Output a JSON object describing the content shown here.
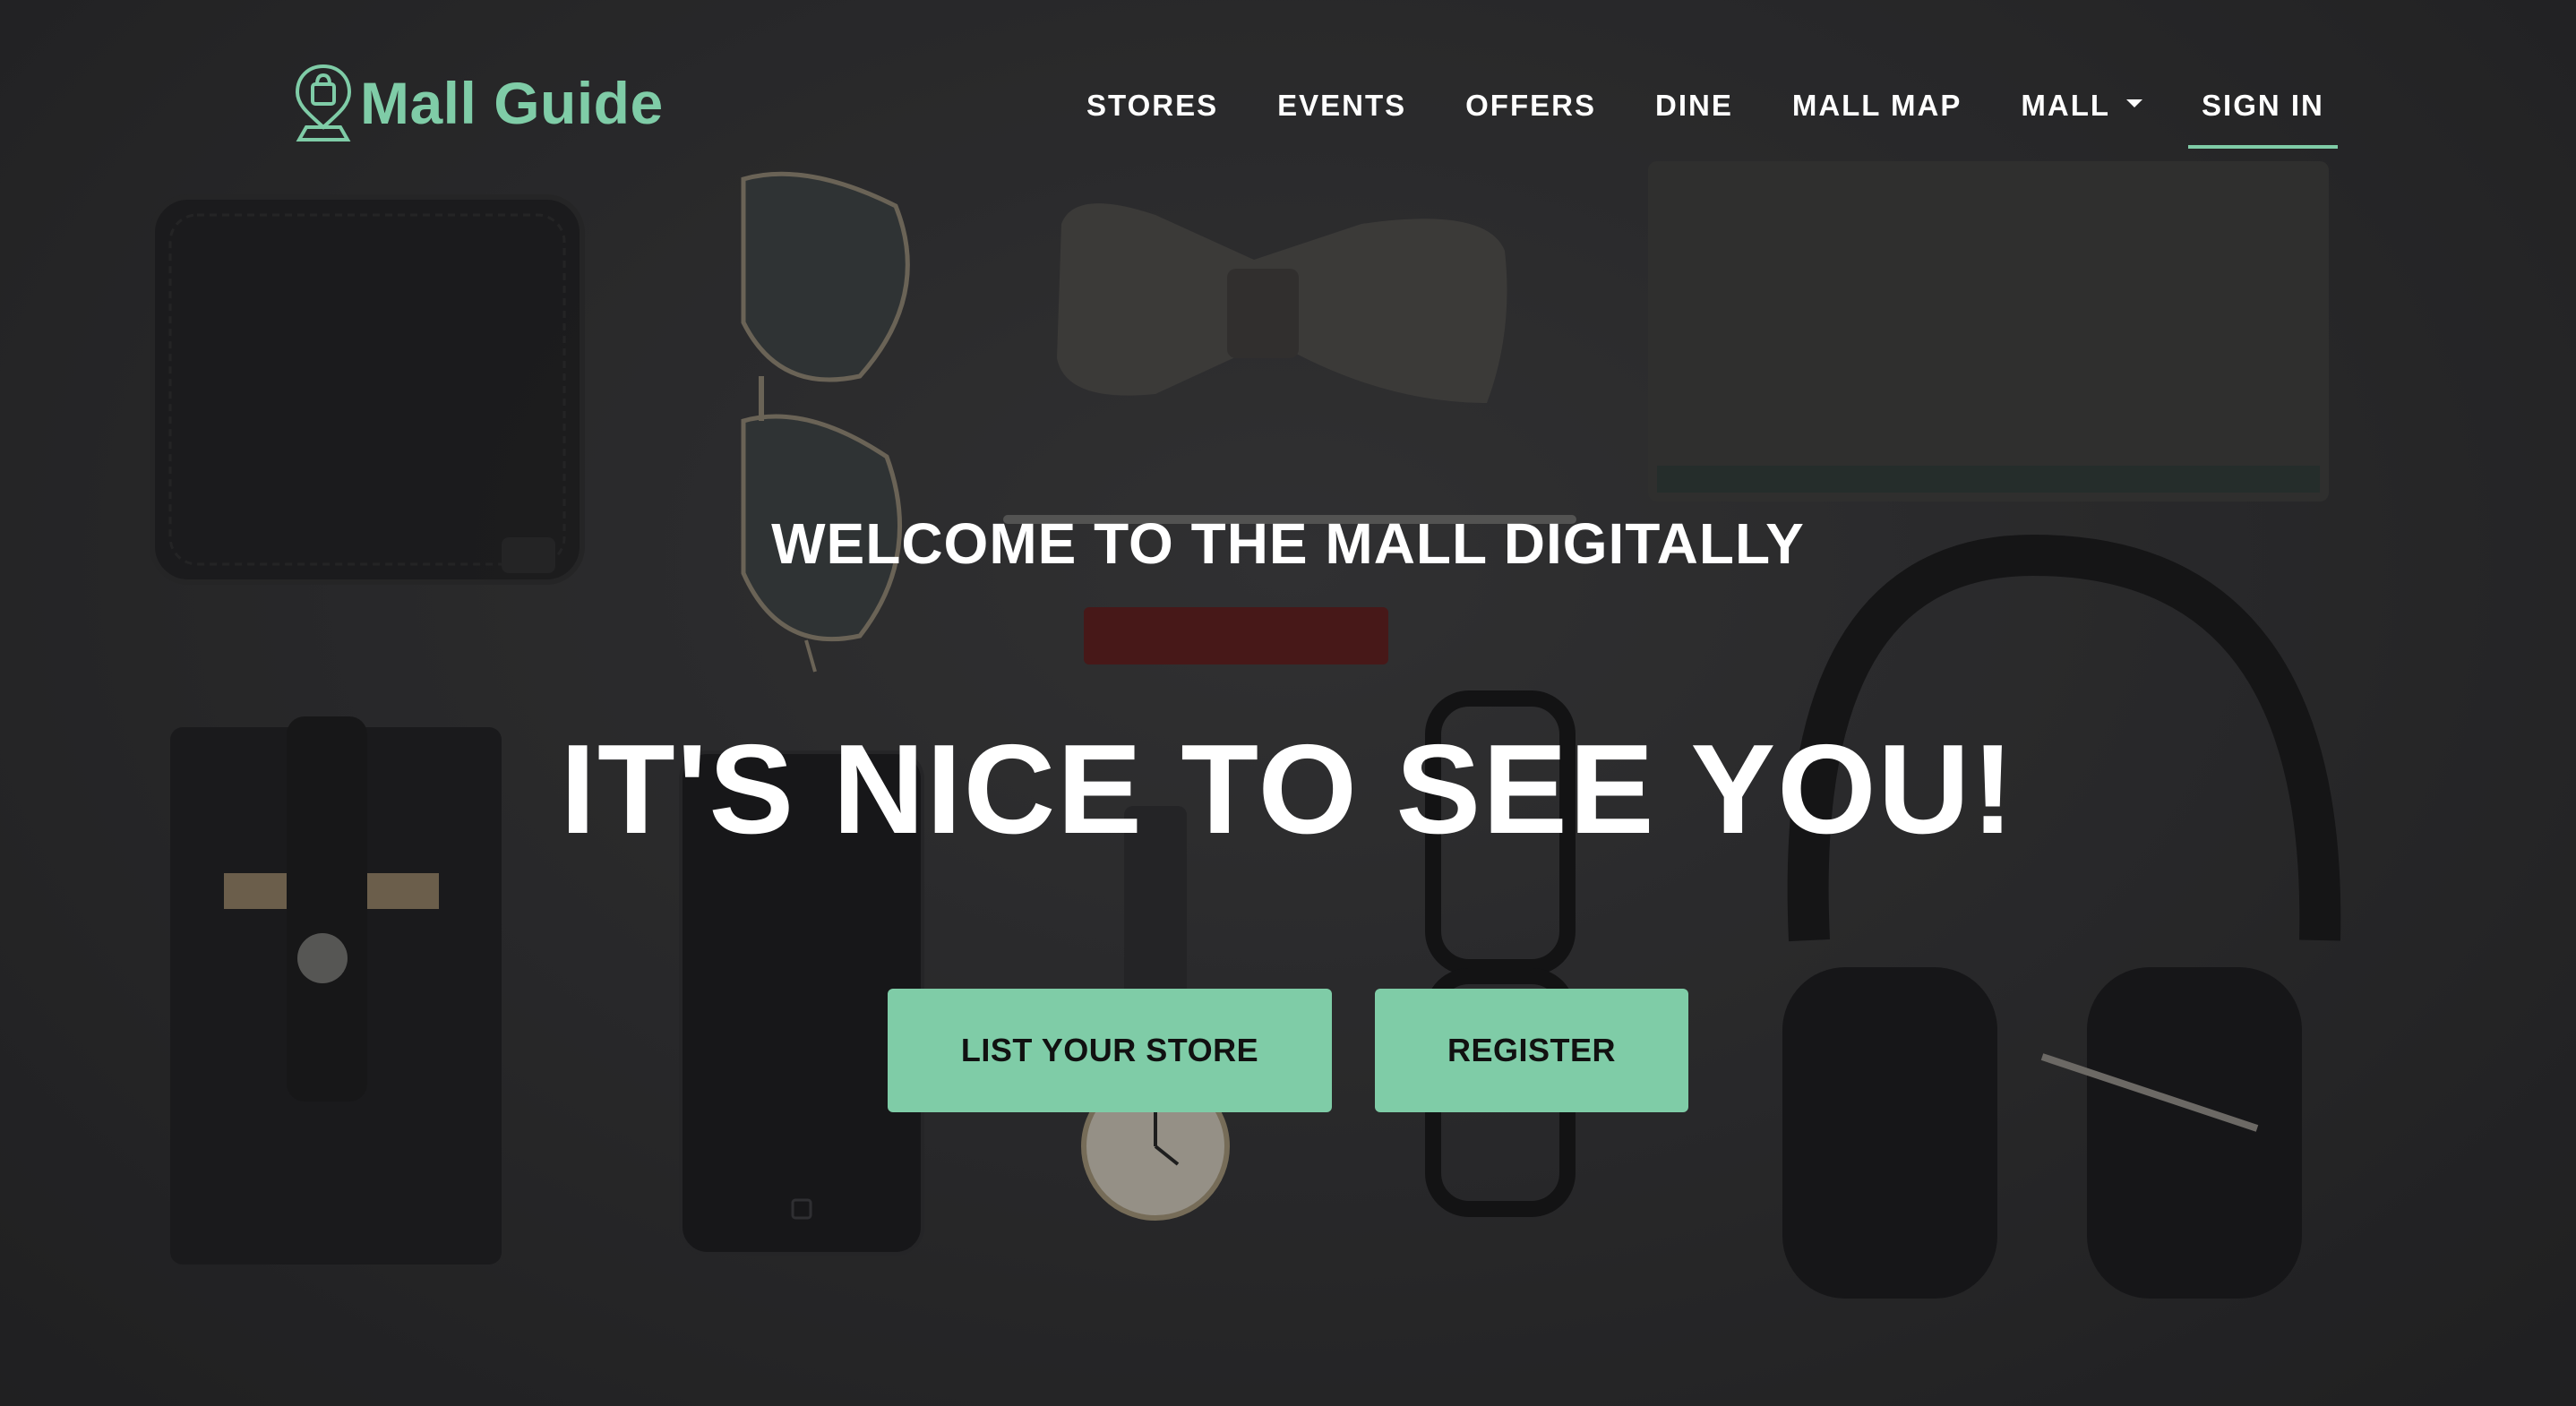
{
  "brand": {
    "name": "Mall Guide",
    "icon": "shopping-bag-location-pin-icon",
    "color": "#7fcca7"
  },
  "nav": {
    "items": [
      {
        "label": "STORES"
      },
      {
        "label": "EVENTS"
      },
      {
        "label": "OFFERS"
      },
      {
        "label": "DINE"
      },
      {
        "label": "MALL MAP"
      },
      {
        "label": "MALL",
        "dropdown": true
      },
      {
        "label": "SIGN IN",
        "active": true
      }
    ]
  },
  "hero": {
    "subheading": "WELCOME TO THE MALL DIGITALLY",
    "heading": "IT'S NICE TO SEE YOU!",
    "buttons": {
      "list_store": "LIST YOUR STORE",
      "register": "REGISTER"
    },
    "background_image": "flat-lay-accessories-photo"
  },
  "colors": {
    "accent": "#7fcca7",
    "text": "#ffffff",
    "background": "#2e2e30"
  }
}
